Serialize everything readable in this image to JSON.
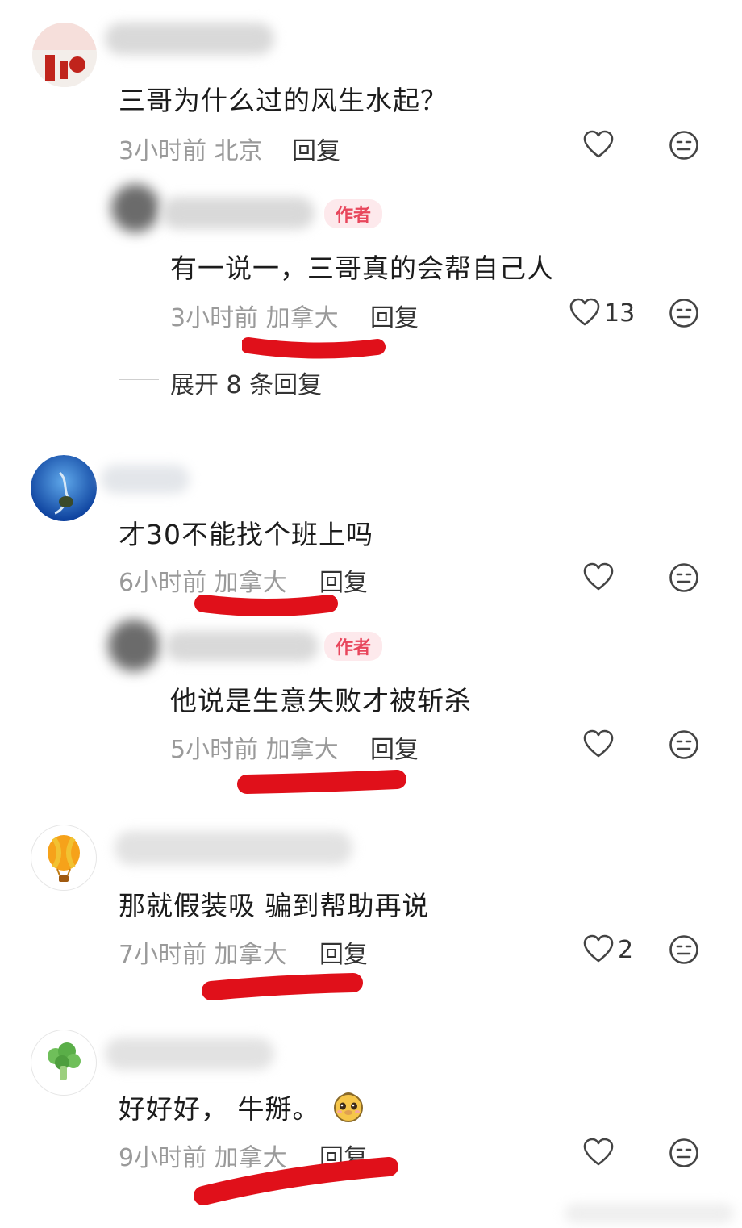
{
  "labels": {
    "author_badge": "作者",
    "reply": "回复"
  },
  "comments": [
    {
      "text": "三哥为什么过的风生水起？",
      "time": "3小时前",
      "location": "北京",
      "likes": ""
    },
    {
      "text": "有一说一，三哥真的会帮自己人",
      "time": "3小时前",
      "location": "加拿大",
      "likes": "13",
      "is_author": true
    },
    {
      "text": "才30不能找个班上吗",
      "time": "6小时前",
      "location": "加拿大",
      "likes": ""
    },
    {
      "text": "他说是生意失败才被斩杀",
      "time": "5小时前",
      "location": "加拿大",
      "likes": "",
      "is_author": true
    },
    {
      "text": "那就假装吸 骗到帮助再说",
      "time": "7小时前",
      "location": "加拿大",
      "likes": "2"
    },
    {
      "text": "好好好， 牛掰。",
      "time": "9小时前",
      "location": "加拿大",
      "likes": ""
    }
  ],
  "expand": {
    "label": "展开 8 条回复"
  },
  "icons": {
    "like": "heart-outline-icon",
    "dislike": "meh-face-icon"
  },
  "colors": {
    "annotation": "#e0101a",
    "badge_text": "#e8465c",
    "badge_bg": "#fde9ec",
    "meta_text": "#9a9a9a"
  }
}
